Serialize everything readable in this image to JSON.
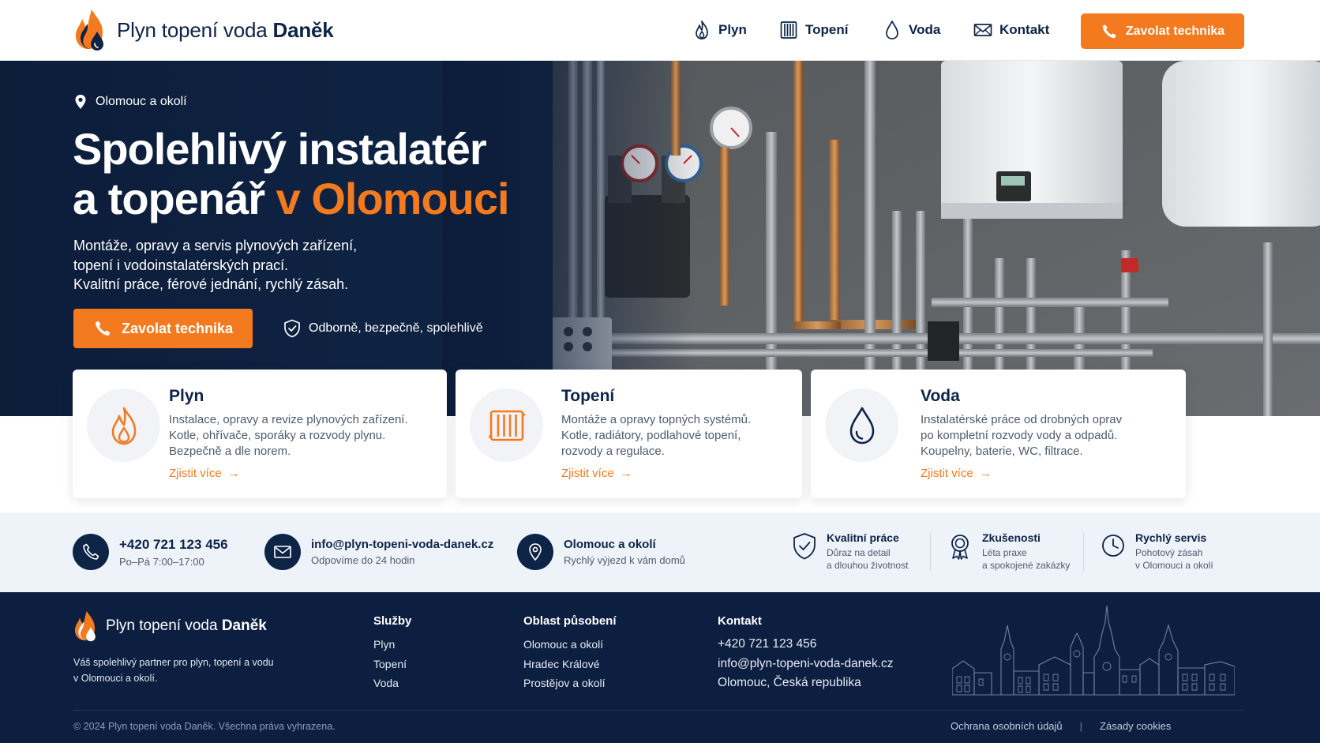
{
  "header": {
    "logo_text": "Plyn topení voda",
    "logo_name": "Daněk",
    "nav": [
      {
        "label": "Plyn",
        "icon": "flame-icon"
      },
      {
        "label": "Topení",
        "icon": "radiator-icon"
      },
      {
        "label": "Voda",
        "icon": "water-drop-icon"
      },
      {
        "label": "Kontakt",
        "icon": "envelope-icon"
      }
    ],
    "cta_label": "Zavolat technika"
  },
  "hero": {
    "location": "Olomouc a okolí",
    "title_line1": "Spolehlivý instalatér",
    "title_line2_start": "a topenář ",
    "title_line2_accent": "v Olomouci",
    "description": [
      "Montáže, opravy a servis plynových zařízení,",
      "topení i vodoinstalatérských prací.",
      "Kvalitní práce, férové jednání, rychlý zásah."
    ],
    "cta_label": "Zavolat technika",
    "trust_label": "Odborně, bezpečně, spolehlivě"
  },
  "services": [
    {
      "title": "Plyn",
      "icon": "flame-icon",
      "description": [
        "Instalace, opravy a revize plynových zařízení.",
        "Kotle, ohřívače, sporáky a rozvody plynu.",
        "Bezpečně a dle norem."
      ],
      "link": "Zjistit více"
    },
    {
      "title": "Topení",
      "icon": "radiator-icon",
      "description": [
        "Montáže a opravy topných systémů.",
        "Kotle, radiátory, podlahové topení,",
        "rozvody a regulace."
      ],
      "link": "Zjistit více"
    },
    {
      "title": "Voda",
      "icon": "water-drop-icon",
      "description": [
        "Instalatérské práce od drobných oprav",
        "po kompletní rozvody vody a odpadů.",
        "Koupelny, baterie, WC, filtrace."
      ],
      "link": "Zjistit více"
    }
  ],
  "contact_band": {
    "phone": {
      "main": "+420 721 123 456",
      "sub": "Po–Pá 7:00–17:00"
    },
    "email": {
      "main": "info@plyn-topeni-voda-danek.cz",
      "sub": "Odpovíme do 24 hodin"
    },
    "area": {
      "main": "Olomouc a okolí",
      "sub": "Rychlý výjezd k vám domů"
    },
    "features": [
      {
        "title": "Kvalitní práce",
        "lines": [
          "Důraz na detail",
          "a dlouhou životnost"
        ],
        "icon": "shield-check-icon"
      },
      {
        "title": "Zkušenosti",
        "lines": [
          "Léta praxe",
          "a spokojené zakázky"
        ],
        "icon": "award-icon"
      },
      {
        "title": "Rychlý servis",
        "lines": [
          "Pohotový zásah",
          "v Olomouci a okolí"
        ],
        "icon": "clock-icon"
      }
    ]
  },
  "footer": {
    "logo_text": "Plyn topení voda",
    "logo_name": "Daněk",
    "about": [
      "Váš spolehlivý partner pro plyn, topení a vodu",
      "v Olomouci a okolí."
    ],
    "columns": [
      {
        "title": "Služby",
        "items": [
          "Plyn",
          "Topení",
          "Voda"
        ]
      },
      {
        "title": "Oblast působení",
        "items": [
          "Olomouc a okolí",
          "Hradec Králové",
          "Prostějov a okolí"
        ]
      },
      {
        "title": "Kontakt",
        "items": [
          "+420 721 123 456",
          "info@plyn-topeni-voda-danek.cz",
          "Olomouc, Česká republika"
        ]
      }
    ],
    "copyright": "© 2024 Plyn topení voda Daněk. Všechna práva vyhrazena.",
    "links": [
      "Ochrana osobních údajů",
      "Zásady cookies"
    ]
  },
  "colors": {
    "navy": "#0e2446",
    "accent": "#f47a1f",
    "footer_bg": "#0c1f40",
    "band_bg": "#eef3fa"
  }
}
